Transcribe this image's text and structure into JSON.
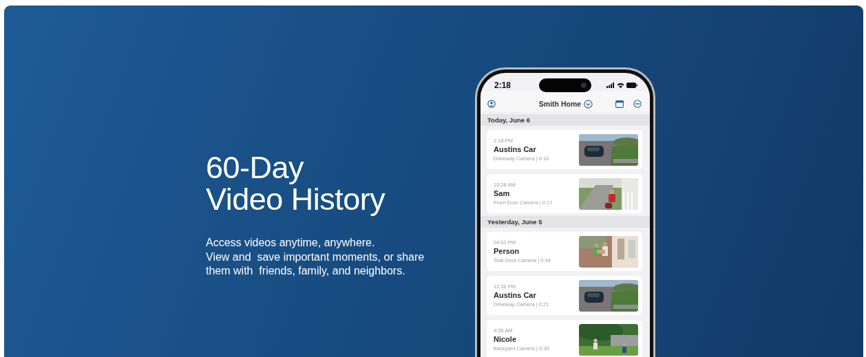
{
  "hero": {
    "title_lines": [
      "60-Day",
      "Video History"
    ],
    "description_lines": [
      "Access videos anytime, anywhere.",
      "View and  save important moments, or share",
      "them with  friends, family, and neighbors."
    ]
  },
  "phone": {
    "status_time": "2:18",
    "home_name": "Smith Home",
    "sections": [
      {
        "heading": "Today, June 6",
        "events": [
          {
            "time": "2:18 PM",
            "name": "Austins Car",
            "detail": "Driveway Camera | 0:10"
          },
          {
            "time": "10:28 AM",
            "name": "Sam",
            "detail": "Front Door Camera | 0:17"
          }
        ]
      },
      {
        "heading": "Yesterday, June 5",
        "events": [
          {
            "time": "04:02 PM",
            "name": "Person",
            "detail": "Side Door Camera | 0:34"
          },
          {
            "time": "12:31 PM",
            "name": "Austins Car",
            "detail": "Driveway Camera | 0:21"
          },
          {
            "time": "9:35 AM",
            "name": "Nicole",
            "detail": "Backyard Camera | 0:39"
          }
        ]
      }
    ]
  }
}
